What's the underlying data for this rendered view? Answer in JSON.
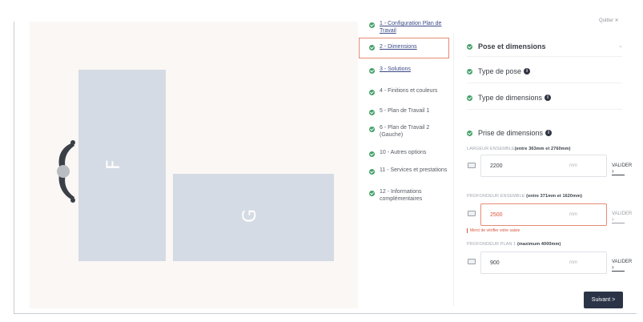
{
  "header": {
    "quit_label": "Quitter ✕"
  },
  "canvas": {
    "block_f_label": "F",
    "block_g_label": "G"
  },
  "steps": [
    {
      "label": "1 - Configuration Plan de Travail",
      "link": true
    },
    {
      "label": "2 - Dimensions",
      "link": true,
      "active": true
    },
    {
      "label": "3 - Solutions",
      "link": true
    },
    {
      "label": "4 - Finitions et couleurs",
      "link": false
    },
    {
      "label": "5 - Plan de Travail 1",
      "link": false
    },
    {
      "label": "6 - Plan de Travail 2 (Gauche)",
      "link": false
    },
    {
      "label": "10 - Autres options",
      "link": false
    },
    {
      "label": "11 - Services et prestations",
      "link": false
    },
    {
      "label": "12 - Informations complémentaires",
      "link": false
    }
  ],
  "panel": {
    "section_pose": "Pose et dimensions",
    "type_pose": "Type de pose",
    "type_dimensions": "Type de dimensions",
    "prise_dimensions": "Prise de dimensions",
    "info_icon": "i",
    "fields": [
      {
        "label_prefix": "LARGEUR ENSEMBLE",
        "label_range": "(entre 363mm et 2760mm)",
        "value": "2200",
        "unit": "mm",
        "valid": "VALIDER",
        "error": ""
      },
      {
        "label_prefix": "PROFONDEUR ENSEMBLE",
        "label_range": "(entre 371mm et 1620mm)",
        "value": "2500",
        "unit": "mm",
        "valid": "VALIDER",
        "error": "Merci de vérifier votre saisie"
      },
      {
        "label_prefix": "PROFONDEUR PLAN 1",
        "label_range": "(maximum 4000mm)",
        "value": "900",
        "unit": "mm",
        "valid": "VALIDER",
        "error": ""
      }
    ],
    "next_label": "Suivant >"
  },
  "colors": {
    "accent": "#2b3447",
    "success": "#44a06a",
    "error": "#d8553e",
    "active_border": "#e58a74",
    "block": "#d5dbe4"
  }
}
